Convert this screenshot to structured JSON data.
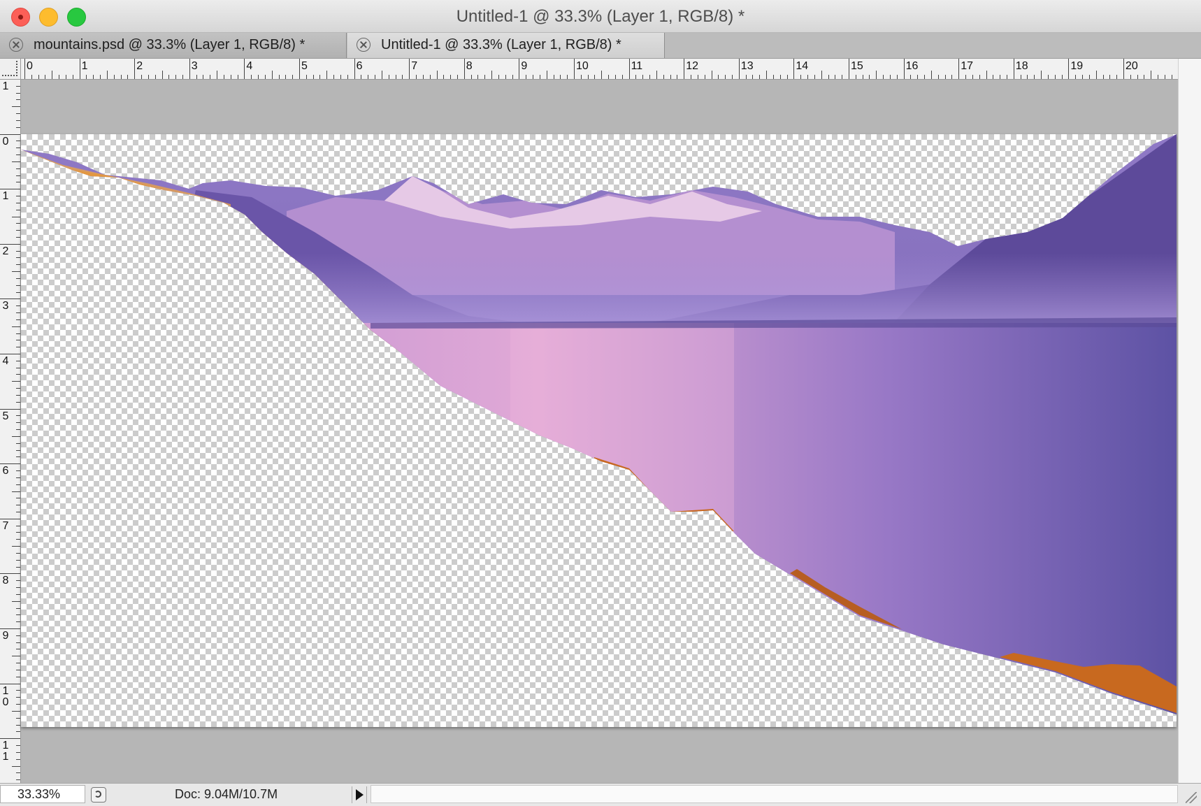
{
  "window": {
    "title": "Untitled-1 @ 33.3% (Layer 1, RGB/8) *"
  },
  "tabs": [
    {
      "label": "mountains.psd @ 33.3% (Layer 1, RGB/8) *",
      "active": false
    },
    {
      "label": "Untitled-1 @ 33.3% (Layer 1, RGB/8) *",
      "active": true
    }
  ],
  "rulers": {
    "top_labels": [
      "0",
      "1",
      "2",
      "3",
      "4",
      "5",
      "6",
      "7",
      "8",
      "9",
      "10",
      "11",
      "12",
      "13",
      "14",
      "15",
      "16",
      "17",
      "18",
      "19",
      "20"
    ],
    "left_labels": [
      "1",
      "0",
      "1",
      "2",
      "3",
      "4",
      "5",
      "6",
      "7",
      "8",
      "9",
      "10",
      "11"
    ]
  },
  "document": {
    "layer": "Layer 1",
    "transparency": true,
    "colors": {
      "sky_mountain": "#7a62b0",
      "lake": "#8f74c9",
      "lake_glow": "#e3a8d4",
      "snow": "#efd9ec",
      "shore_foliage": "#d97a2b"
    }
  },
  "status": {
    "zoom": "33.33%",
    "doc_info": "Doc: 9.04M/10.7M"
  },
  "icons": [
    "close-tab-icon",
    "ruler-origin-icon",
    "status-menu-icon",
    "status-arrow-icon",
    "resize-grip-icon"
  ]
}
